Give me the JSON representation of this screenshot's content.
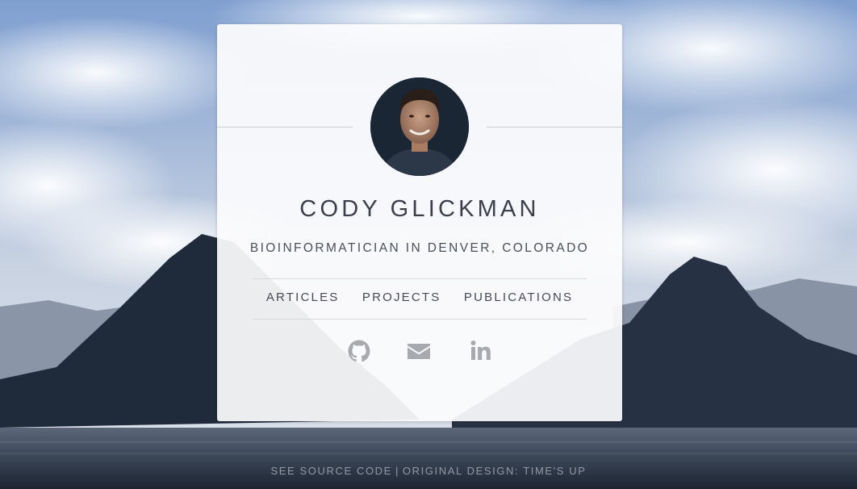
{
  "profile": {
    "name": "CODY GLICKMAN",
    "subtitle": "BIOINFORMATICIAN IN DENVER, COLORADO"
  },
  "nav": {
    "items": [
      {
        "label": "ARTICLES"
      },
      {
        "label": "PROJECTS"
      },
      {
        "label": "PUBLICATIONS"
      }
    ]
  },
  "social": {
    "icons": [
      "github-icon",
      "mail-icon",
      "linkedin-icon"
    ],
    "icon_color": "#a6a9ae"
  },
  "footer": {
    "source_link": "SEE SOURCE CODE",
    "separator": "|",
    "design_link": "ORIGINAL DESIGN: TIME'S UP"
  },
  "colors": {
    "card_bg": "#fcfcfd",
    "text": "#3a3f4b",
    "sky": "#6b8fc4",
    "mountain": "#1c2533"
  }
}
